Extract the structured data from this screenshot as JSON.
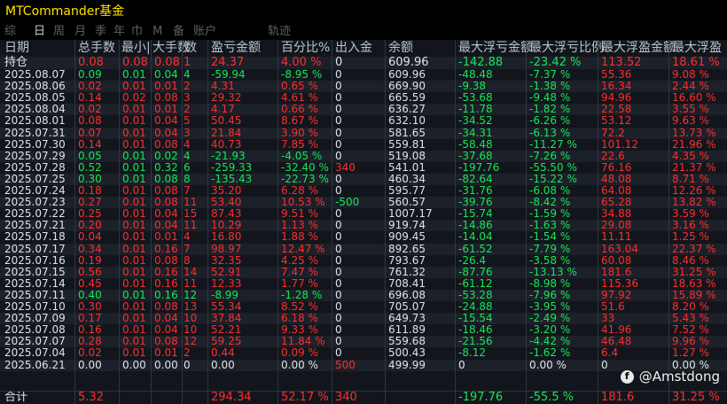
{
  "window": {
    "title": "MTCommander基金"
  },
  "tabs": [
    {
      "label": "综",
      "active": false
    },
    {
      "label": "日",
      "active": true
    },
    {
      "label": "周",
      "active": false
    },
    {
      "label": "月",
      "active": false
    },
    {
      "label": "季",
      "active": false
    },
    {
      "label": "年",
      "active": false
    },
    {
      "label": "巾",
      "active": false
    },
    {
      "label": "M",
      "active": false
    },
    {
      "label": "备",
      "active": false
    },
    {
      "label": "账户",
      "active": false
    },
    {
      "label": "轨迹",
      "active": false
    }
  ],
  "table": {
    "headers": [
      "日期",
      "总手数",
      "最小|",
      "大手数",
      "数",
      "盈亏金额",
      "百分比%",
      "出入金",
      "余额",
      "最大浮亏金额",
      "最大浮亏比例",
      "最大浮盈金额",
      "最大浮盈"
    ],
    "holding": {
      "date": "持仓",
      "total": "0.08",
      "min": "0.08",
      "max": "0.08",
      "count": "1",
      "pnl": "24.37",
      "pct": "4.00 %",
      "flow": "0",
      "balance": "609.96",
      "maxdd": "-142.88",
      "maxddpct": "-23.42 %",
      "maxgain": "113.52",
      "maxgainpct": "18.61 %"
    },
    "rows": [
      {
        "date": "2025.08.07",
        "total": "0.09",
        "min": "0.01",
        "max": "0.04",
        "count": "4",
        "pnl": "-59.94",
        "pct": "-8.95 %",
        "flow": "0",
        "balance": "609.96",
        "maxdd": "-48.48",
        "maxddpct": "-7.37 %",
        "maxgain": "55.36",
        "maxgainpct": "9.08 %"
      },
      {
        "date": "2025.08.06",
        "total": "0.02",
        "min": "0.01",
        "max": "0.01",
        "count": "2",
        "pnl": "4.31",
        "pct": "0.65 %",
        "flow": "0",
        "balance": "669.90",
        "maxdd": "-9.38",
        "maxddpct": "-1.38 %",
        "maxgain": "16.34",
        "maxgainpct": "2.44 %"
      },
      {
        "date": "2025.08.05",
        "total": "0.14",
        "min": "0.02",
        "max": "0.08",
        "count": "3",
        "pnl": "29.32",
        "pct": "4.61 %",
        "flow": "0",
        "balance": "665.59",
        "maxdd": "-53.68",
        "maxddpct": "-9.48 %",
        "maxgain": "94.96",
        "maxgainpct": "16.60 %"
      },
      {
        "date": "2025.08.04",
        "total": "0.02",
        "min": "0.01",
        "max": "0.01",
        "count": "2",
        "pnl": "4.17",
        "pct": "0.66 %",
        "flow": "0",
        "balance": "636.27",
        "maxdd": "-11.78",
        "maxddpct": "-1.82 %",
        "maxgain": "22.58",
        "maxgainpct": "3.55 %"
      },
      {
        "date": "2025.08.01",
        "total": "0.08",
        "min": "0.01",
        "max": "0.04",
        "count": "5",
        "pnl": "50.45",
        "pct": "8.67 %",
        "flow": "0",
        "balance": "632.10",
        "maxdd": "-34.52",
        "maxddpct": "-6.26 %",
        "maxgain": "53.12",
        "maxgainpct": "9.63 %"
      },
      {
        "date": "2025.07.31",
        "total": "0.07",
        "min": "0.01",
        "max": "0.04",
        "count": "3",
        "pnl": "21.84",
        "pct": "3.90 %",
        "flow": "0",
        "balance": "581.65",
        "maxdd": "-34.31",
        "maxddpct": "-6.13 %",
        "maxgain": "72.2",
        "maxgainpct": "13.73 %"
      },
      {
        "date": "2025.07.30",
        "total": "0.14",
        "min": "0.01",
        "max": "0.08",
        "count": "4",
        "pnl": "40.73",
        "pct": "7.85 %",
        "flow": "0",
        "balance": "559.81",
        "maxdd": "-58.48",
        "maxddpct": "-11.27 %",
        "maxgain": "101.12",
        "maxgainpct": "21.96 %"
      },
      {
        "date": "2025.07.29",
        "total": "0.05",
        "min": "0.01",
        "max": "0.02",
        "count": "4",
        "pnl": "-21.93",
        "pct": "-4.05 %",
        "flow": "0",
        "balance": "519.08",
        "maxdd": "-37.68",
        "maxddpct": "-7.26 %",
        "maxgain": "22.6",
        "maxgainpct": "4.35 %"
      },
      {
        "date": "2025.07.28",
        "total": "0.52",
        "min": "0.01",
        "max": "0.32",
        "count": "6",
        "pnl": "-259.33",
        "pct": "-32.40 %",
        "flow": "340",
        "balance": "541.01",
        "maxdd": "-197.76",
        "maxddpct": "-55.50 %",
        "maxgain": "76.16",
        "maxgainpct": "21.37 %"
      },
      {
        "date": "2025.07.25",
        "total": "0.30",
        "min": "0.01",
        "max": "0.08",
        "count": "8",
        "pnl": "-135.43",
        "pct": "-22.73 %",
        "flow": "0",
        "balance": "460.34",
        "maxdd": "-82.64",
        "maxddpct": "-15.22 %",
        "maxgain": "48.08",
        "maxgainpct": "8.71 %"
      },
      {
        "date": "2025.07.24",
        "total": "0.18",
        "min": "0.01",
        "max": "0.08",
        "count": "7",
        "pnl": "35.20",
        "pct": "6.28 %",
        "flow": "0",
        "balance": "595.77",
        "maxdd": "-31.76",
        "maxddpct": "-6.08 %",
        "maxgain": "64.08",
        "maxgainpct": "12.26 %"
      },
      {
        "date": "2025.07.23",
        "total": "0.27",
        "min": "0.01",
        "max": "0.08",
        "count": "11",
        "pnl": "53.40",
        "pct": "10.53 %",
        "flow": "-500",
        "balance": "560.57",
        "maxdd": "-39.76",
        "maxddpct": "-8.42 %",
        "maxgain": "65.28",
        "maxgainpct": "13.82 %"
      },
      {
        "date": "2025.07.22",
        "total": "0.25",
        "min": "0.01",
        "max": "0.04",
        "count": "15",
        "pnl": "87.43",
        "pct": "9.51 %",
        "flow": "0",
        "balance": "1007.17",
        "maxdd": "-15.74",
        "maxddpct": "-1.59 %",
        "maxgain": "34.88",
        "maxgainpct": "3.59 %"
      },
      {
        "date": "2025.07.21",
        "total": "0.20",
        "min": "0.01",
        "max": "0.04",
        "count": "11",
        "pnl": "10.29",
        "pct": "1.13 %",
        "flow": "0",
        "balance": "919.74",
        "maxdd": "-14.86",
        "maxddpct": "-1.63 %",
        "maxgain": "29.08",
        "maxgainpct": "3.16 %"
      },
      {
        "date": "2025.07.18",
        "total": "0.04",
        "min": "0.01",
        "max": "0.01",
        "count": "4",
        "pnl": "16.80",
        "pct": "1.88 %",
        "flow": "0",
        "balance": "909.45",
        "maxdd": "-14.04",
        "maxddpct": "-1.54 %",
        "maxgain": "11.11",
        "maxgainpct": "1.25 %"
      },
      {
        "date": "2025.07.17",
        "total": "0.34",
        "min": "0.01",
        "max": "0.16",
        "count": "7",
        "pnl": "98.97",
        "pct": "12.47 %",
        "flow": "0",
        "balance": "892.65",
        "maxdd": "-61.52",
        "maxddpct": "-7.79 %",
        "maxgain": "163.04",
        "maxgainpct": "22.37 %"
      },
      {
        "date": "2025.07.16",
        "total": "0.19",
        "min": "0.01",
        "max": "0.08",
        "count": "8",
        "pnl": "32.35",
        "pct": "4.25 %",
        "flow": "0",
        "balance": "793.67",
        "maxdd": "-26.4",
        "maxddpct": "-3.58 %",
        "maxgain": "60.08",
        "maxgainpct": "8.46 %"
      },
      {
        "date": "2025.07.15",
        "total": "0.56",
        "min": "0.01",
        "max": "0.16",
        "count": "14",
        "pnl": "52.91",
        "pct": "7.47 %",
        "flow": "0",
        "balance": "761.32",
        "maxdd": "-87.76",
        "maxddpct": "-13.13 %",
        "maxgain": "181.6",
        "maxgainpct": "31.25 %"
      },
      {
        "date": "2025.07.14",
        "total": "0.45",
        "min": "0.01",
        "max": "0.16",
        "count": "11",
        "pnl": "12.33",
        "pct": "1.77 %",
        "flow": "0",
        "balance": "708.41",
        "maxdd": "-61.12",
        "maxddpct": "-8.98 %",
        "maxgain": "115.36",
        "maxgainpct": "18.63 %"
      },
      {
        "date": "2025.07.11",
        "total": "0.40",
        "min": "0.01",
        "max": "0.16",
        "count": "12",
        "pnl": "-8.99",
        "pct": "-1.28 %",
        "flow": "0",
        "balance": "696.08",
        "maxdd": "-53.28",
        "maxddpct": "-7.96 %",
        "maxgain": "97.92",
        "maxgainpct": "15.89 %"
      },
      {
        "date": "2025.07.10",
        "total": "0.30",
        "min": "0.01",
        "max": "0.08",
        "count": "13",
        "pnl": "55.34",
        "pct": "8.52 %",
        "flow": "0",
        "balance": "705.07",
        "maxdd": "-24.88",
        "maxddpct": "-3.95 %",
        "maxgain": "51.6",
        "maxgainpct": "8.20 %"
      },
      {
        "date": "2025.07.09",
        "total": "0.17",
        "min": "0.01",
        "max": "0.04",
        "count": "10",
        "pnl": "37.84",
        "pct": "6.18 %",
        "flow": "0",
        "balance": "649.73",
        "maxdd": "-15.54",
        "maxddpct": "-2.49 %",
        "maxgain": "33",
        "maxgainpct": "5.43 %"
      },
      {
        "date": "2025.07.08",
        "total": "0.16",
        "min": "0.01",
        "max": "0.04",
        "count": "10",
        "pnl": "52.21",
        "pct": "9.33 %",
        "flow": "0",
        "balance": "611.89",
        "maxdd": "-18.46",
        "maxddpct": "-3.20 %",
        "maxgain": "41.96",
        "maxgainpct": "7.52 %"
      },
      {
        "date": "2025.07.07",
        "total": "0.28",
        "min": "0.01",
        "max": "0.08",
        "count": "12",
        "pnl": "59.25",
        "pct": "11.84 %",
        "flow": "0",
        "balance": "559.68",
        "maxdd": "-21.56",
        "maxddpct": "-4.42 %",
        "maxgain": "46.48",
        "maxgainpct": "9.96 %"
      },
      {
        "date": "2025.07.04",
        "total": "0.02",
        "min": "0.01",
        "max": "0.01",
        "count": "2",
        "pnl": "0.44",
        "pct": "0.09 %",
        "flow": "0",
        "balance": "500.43",
        "maxdd": "-8.12",
        "maxddpct": "-1.62 %",
        "maxgain": "6.4",
        "maxgainpct": "1.27 %"
      },
      {
        "date": "2025.06.21",
        "total": "0.00",
        "min": "0.00",
        "max": "0.00",
        "count": "0",
        "pnl": "0.00",
        "pct": "0.00 %",
        "flow": "500",
        "balance": "499.99",
        "maxdd": "0",
        "maxddpct": "0.00 %",
        "maxgain": "0",
        "maxgainpct": "0.00 %"
      }
    ],
    "total": {
      "date": "合计",
      "total": "5.32",
      "min": "",
      "max": "",
      "count": "",
      "pnl": "294.34",
      "pct": "52.17 %",
      "flow": "340",
      "balance": "",
      "maxdd": "-197.76",
      "maxddpct": "-55.5 %",
      "maxgain": "181.6",
      "maxgainpct": "31.25 %"
    }
  },
  "watermark": {
    "icon": "facebook-icon",
    "text": "@Amstdong"
  },
  "colors": {
    "positive": "#ff2d2d",
    "negative": "#15e855",
    "title": "#ffe300",
    "neutral": "#dfe3e8"
  }
}
